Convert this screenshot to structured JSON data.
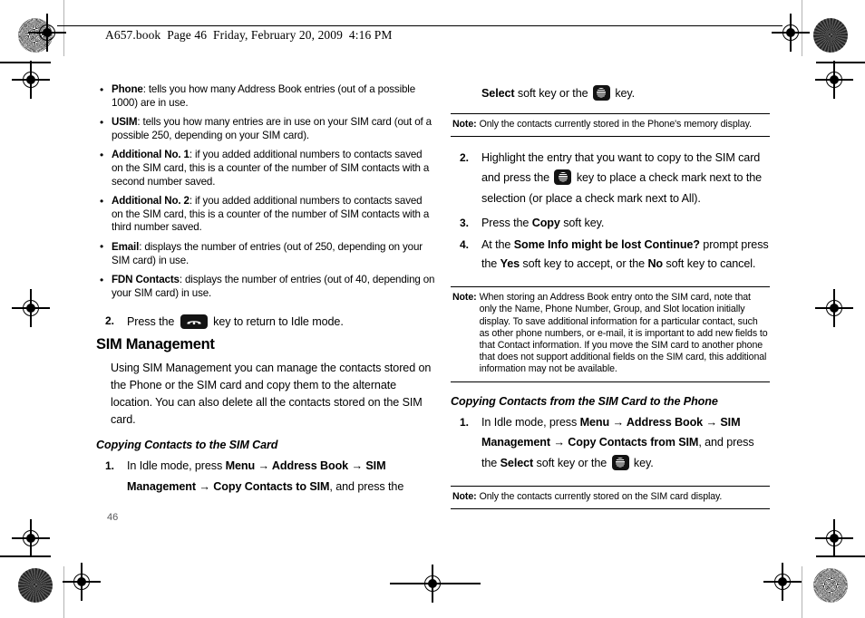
{
  "document": {
    "running_header": "A657.book  Page 46  Friday, February 20, 2009  4:16 PM",
    "page_number": "46"
  },
  "icons": {
    "att_key": "att-globe-key-icon",
    "end_key": "end-call-key-icon"
  },
  "left_column": {
    "bullets": [
      {
        "term": "Phone",
        "text": ": tells you how many Address Book entries (out of a possible 1000) are in use."
      },
      {
        "term": "USIM",
        "text": ": tells you how many entries are in use on your SIM card (out of a possible 250, depending on your SIM card)."
      },
      {
        "term": "Additional No. 1",
        "text": ": if you added additional numbers to contacts saved on the SIM card, this is a counter of the number of SIM contacts with a second number saved."
      },
      {
        "term": "Additional No. 2",
        "text": ": if you added additional numbers to contacts saved on the SIM card, this is a counter of the number of SIM contacts with a third number saved."
      },
      {
        "term": "Email",
        "text": ": displays the number of entries (out of 250, depending on your SIM card) in use."
      },
      {
        "term": "FDN Contacts",
        "text": ": displays the number of entries (out of 40, depending on your SIM card) in use."
      }
    ],
    "step2": {
      "num": "2.",
      "before_icon": "Press the",
      "after_icon": "key to return to Idle mode."
    },
    "section_heading": "SIM Management",
    "intro_paragraph": "Using SIM Management you can manage the contacts stored on the Phone or the SIM card and copy them to the alternate location. You can also delete all the contacts stored on the SIM card.",
    "sub_heading": "Copying Contacts to the SIM Card",
    "step1": {
      "num": "1.",
      "part_a": "In Idle mode, press ",
      "menu_path": "Menu → Address Book → SIM Management → Copy Contacts to SIM",
      "part_b": ", and press the"
    }
  },
  "right_column": {
    "continuation": {
      "bold_lead": "Select",
      "mid": " soft key or the ",
      "tail": " key."
    },
    "note1": {
      "label": "Note:",
      "text": "Only the contacts currently stored in the Phone's memory display."
    },
    "steps": [
      {
        "num": "2.",
        "part_a": "Highlight the entry that you want to copy to the SIM card and press the",
        "part_b": "key to place a check mark next to the selection (or place a check mark next to All)."
      },
      {
        "num": "3.",
        "part_a": "Press the ",
        "bold": "Copy",
        "part_b": " soft key."
      },
      {
        "num": "4.",
        "part_a": "At the ",
        "bold_prompt": "Some Info might be lost Continue?",
        "part_b": " prompt press the ",
        "bold_yes": "Yes",
        "part_c": " soft key to accept, or the ",
        "bold_no": "No",
        "part_d": " soft key to cancel."
      }
    ],
    "note2": {
      "label": "Note:",
      "text": "When storing an Address Book entry onto the SIM card, note that only the Name, Phone Number, Group, and Slot location initially display. To save additional information for a particular contact, such as other phone numbers, or e-mail, it is important to add new fields to that Contact information. If you move the SIM card to another phone that does not support additional fields on the SIM card, this additional information may not be available."
    },
    "sub_heading": "Copying Contacts from the SIM Card to the Phone",
    "step1": {
      "num": "1.",
      "part_a": "In Idle mode, press ",
      "menu_path": "Menu → Address Book → SIM Management → Copy Contacts from SIM",
      "part_b": ", and press the ",
      "bold_select": "Select",
      "part_c": " soft key or the ",
      "part_d": " key."
    },
    "note3": {
      "label": "Note:",
      "text": "Only the contacts currently stored on the SIM card display."
    }
  }
}
